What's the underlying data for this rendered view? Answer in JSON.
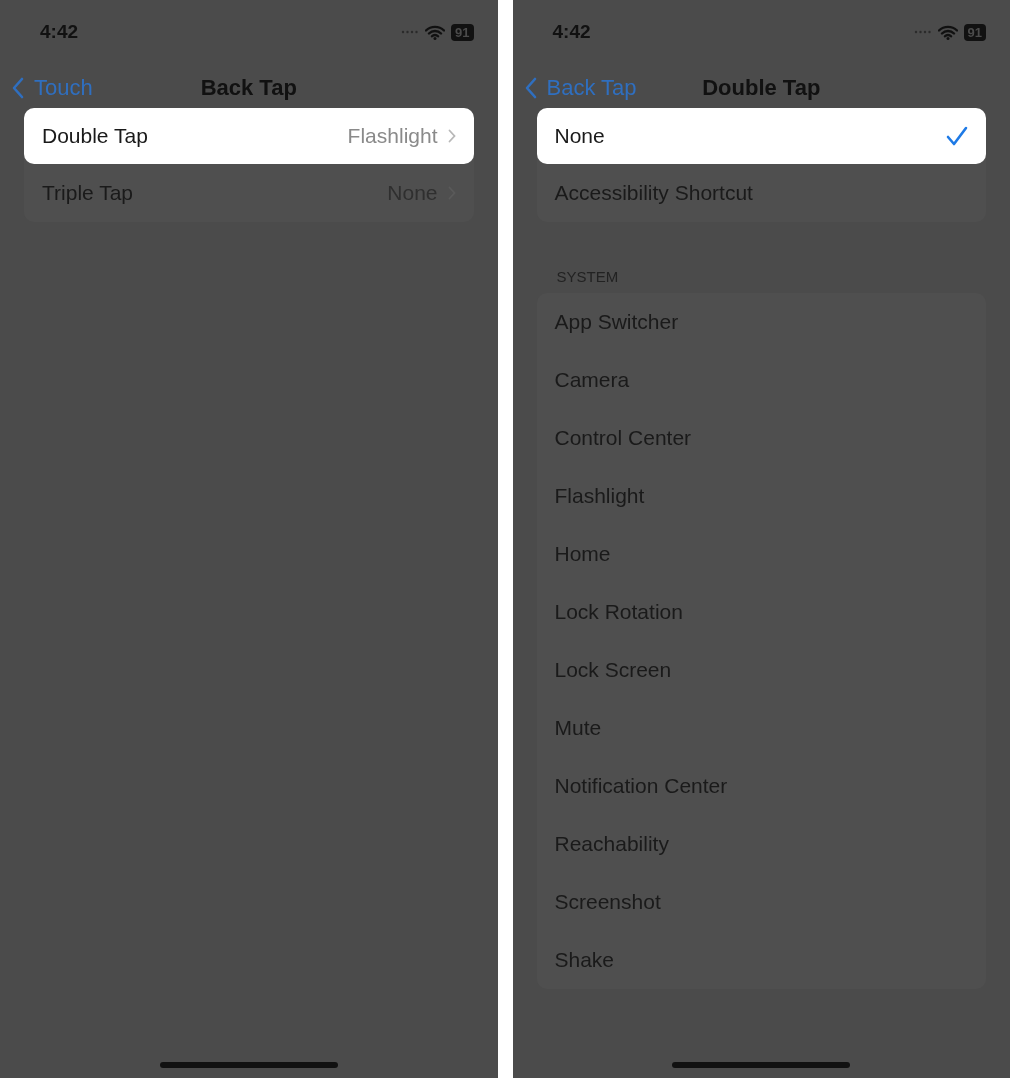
{
  "screens": [
    {
      "status_bar": {
        "time": "4:42",
        "battery": "91"
      },
      "nav": {
        "back": "Touch",
        "title": "Back Tap"
      },
      "sections": [
        {
          "rows": [
            {
              "label": "Double Tap",
              "value": "Flashlight",
              "kind": "disclosure",
              "selected": true
            },
            {
              "label": "Triple Tap",
              "value": "None",
              "kind": "disclosure",
              "selected": false
            }
          ]
        }
      ]
    },
    {
      "status_bar": {
        "time": "4:42",
        "battery": "91"
      },
      "nav": {
        "back": "Back Tap",
        "title": "Double Tap"
      },
      "sections": [
        {
          "rows": [
            {
              "label": "None",
              "kind": "check",
              "checked": true,
              "selected": true
            },
            {
              "label": "Accessibility Shortcut",
              "kind": "check",
              "checked": false,
              "selected": false
            }
          ]
        },
        {
          "header": "SYSTEM",
          "rows": [
            {
              "label": "App Switcher",
              "kind": "check",
              "checked": false,
              "selected": false
            },
            {
              "label": "Camera",
              "kind": "check",
              "checked": false,
              "selected": false
            },
            {
              "label": "Control Center",
              "kind": "check",
              "checked": false,
              "selected": false
            },
            {
              "label": "Flashlight",
              "kind": "check",
              "checked": false,
              "selected": false
            },
            {
              "label": "Home",
              "kind": "check",
              "checked": false,
              "selected": false
            },
            {
              "label": "Lock Rotation",
              "kind": "check",
              "checked": false,
              "selected": false
            },
            {
              "label": "Lock Screen",
              "kind": "check",
              "checked": false,
              "selected": false
            },
            {
              "label": "Mute",
              "kind": "check",
              "checked": false,
              "selected": false
            },
            {
              "label": "Notification Center",
              "kind": "check",
              "checked": false,
              "selected": false
            },
            {
              "label": "Reachability",
              "kind": "check",
              "checked": false,
              "selected": false
            },
            {
              "label": "Screenshot",
              "kind": "check",
              "checked": false,
              "selected": false
            },
            {
              "label": "Shake",
              "kind": "check",
              "checked": false,
              "selected": false
            }
          ]
        }
      ]
    }
  ]
}
